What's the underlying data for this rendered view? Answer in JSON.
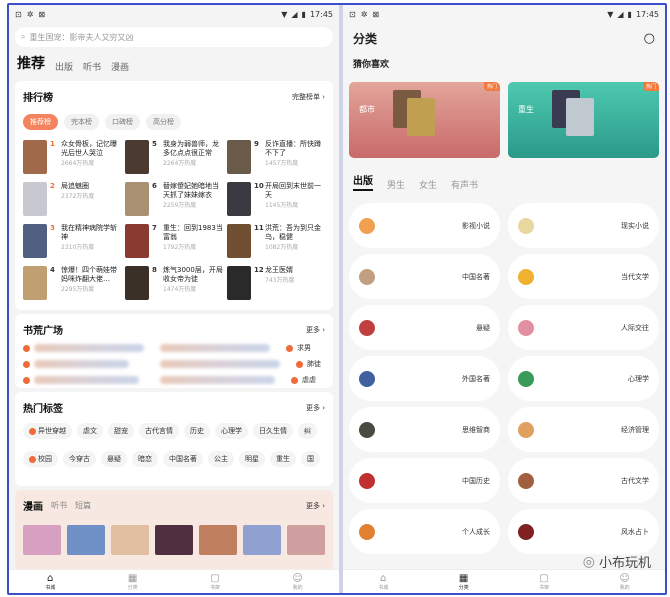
{
  "left": {
    "status": {
      "time": "17:45"
    },
    "search": {
      "placeholder": "重生国宠：影帝夫人又穷又凶"
    },
    "tabs": [
      "推荐",
      "出版",
      "听书",
      "漫画"
    ],
    "ranking": {
      "title": "排行榜",
      "more": "完整榜单 ›",
      "pills": [
        "推荐榜",
        "完本榜",
        "口碑榜",
        "高分榜"
      ],
      "items": [
        {
          "rank": "1",
          "title": "众女骨板，记忆曝光后世人哭泣",
          "heat": "2664万热度",
          "color": "#a06a4a"
        },
        {
          "rank": "5",
          "title": "我身为弱兽师，龙多亿点点很正常",
          "heat": "2264万热度",
          "color": "#4a3a30"
        },
        {
          "rank": "9",
          "title": "反诈直播：所快蹲不下了",
          "heat": "1457万热度",
          "color": "#6a5a4a"
        },
        {
          "rank": "2",
          "title": "局追魅圈",
          "heat": "2372万热度",
          "color": "#c8c8d0"
        },
        {
          "rank": "6",
          "title": "替嫁傻妃她暗地当天抓了妹妹嫁衣",
          "heat": "2259万热度",
          "color": "#a89070"
        },
        {
          "rank": "10",
          "title": "开局回到末世前一天",
          "heat": "1145万热度",
          "color": "#3a3a40"
        },
        {
          "rank": "3",
          "title": "我在精神病院学斩神",
          "heat": "2310万热度",
          "color": "#506080"
        },
        {
          "rank": "7",
          "title": "重生：回到1983当富翁",
          "heat": "1792万热度",
          "color": "#8a3a30"
        },
        {
          "rank": "11",
          "title": "洪荒：吾为到只金乌，稳健",
          "heat": "1082万热度",
          "color": "#705030"
        },
        {
          "rank": "4",
          "title": "惊爆！四个萌娃带妈咪炸翻大佬…",
          "heat": "2295万热度",
          "color": "#c0a070"
        },
        {
          "rank": "8",
          "title": "炼气3000层，开局收女帝为徒",
          "heat": "1474万热度",
          "color": "#3a3028"
        },
        {
          "rank": "12",
          "title": "龙王医婿",
          "heat": "743万热度",
          "color": "#2a2a2a"
        }
      ]
    },
    "shuhuang": {
      "title": "书荒广场",
      "more": "更多 ›",
      "right_items": [
        "求男",
        "肺徒",
        "虐虐"
      ]
    },
    "hot_tags": {
      "title": "热门标签",
      "more": "更多 ›",
      "row1": [
        "异世穿越",
        "虐文",
        "甜宠",
        "古代言情",
        "历史",
        "心理学",
        "日久生情",
        "纠"
      ],
      "row2": [
        "校园",
        "今穿古",
        "悬疑",
        "暗恋",
        "中国名著",
        "公主",
        "明星",
        "重生",
        "国"
      ]
    },
    "manhua": {
      "tabs": [
        "漫画",
        "听书",
        "短篇"
      ],
      "more": "更多 ›"
    },
    "nav": [
      "书城",
      "分类",
      "书架",
      "我的"
    ]
  },
  "right": {
    "status": {
      "time": "17:45"
    },
    "title": "分类",
    "guess": "猜你喜欢",
    "banners": [
      {
        "label": "都市",
        "hot": "热门"
      },
      {
        "label": "重生",
        "hot": "热门"
      }
    ],
    "tabs": [
      "出版",
      "男生",
      "女生",
      "有声书"
    ],
    "categories": [
      {
        "name": "影视小说",
        "color": "#f0a050"
      },
      {
        "name": "现实小说",
        "color": "#e8d8a0"
      },
      {
        "name": "中国名著",
        "color": "#c0a080"
      },
      {
        "name": "当代文学",
        "color": "#f0b030"
      },
      {
        "name": "悬疑",
        "color": "#c04040"
      },
      {
        "name": "人际交往",
        "color": "#e090a0"
      },
      {
        "name": "外国名著",
        "color": "#4060a0"
      },
      {
        "name": "心理学",
        "color": "#3a9a5a"
      },
      {
        "name": "思维智商",
        "color": "#4a4a40"
      },
      {
        "name": "经济管理",
        "color": "#e0a060"
      },
      {
        "name": "中国历史",
        "color": "#c03030"
      },
      {
        "name": "古代文学",
        "color": "#a06040"
      },
      {
        "name": "个人成长",
        "color": "#e08030"
      },
      {
        "name": "风水占卜",
        "color": "#802020"
      }
    ],
    "nav": [
      "书城",
      "分类",
      "书架",
      "我的"
    ]
  },
  "watermark": "小布玩机"
}
